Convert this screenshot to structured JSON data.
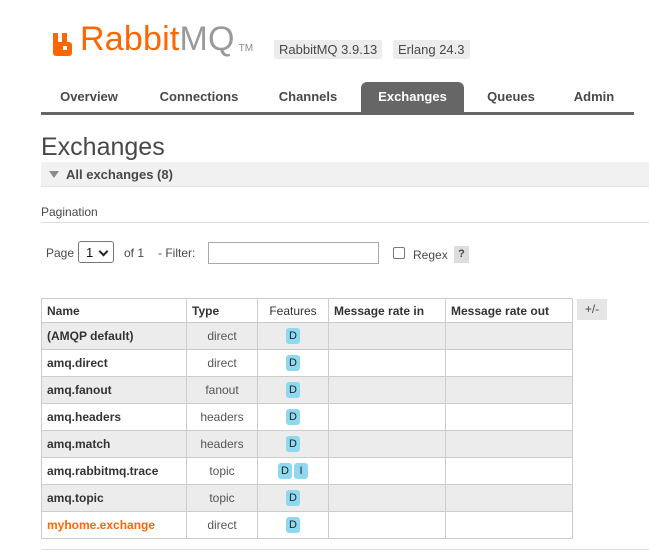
{
  "header": {
    "logo_word": "Rabbit",
    "logo_suffix": "MQ",
    "logo_tm": "TM",
    "version_label": "RabbitMQ 3.9.13",
    "erlang_label": "Erlang 24.3"
  },
  "tabs": [
    "Overview",
    "Connections",
    "Channels",
    "Exchanges",
    "Queues",
    "Admin"
  ],
  "active_tab": "Exchanges",
  "page": {
    "title": "Exchanges",
    "section_title": "All exchanges (8)",
    "pagination_label": "Pagination"
  },
  "pagination": {
    "page_label": "Page",
    "page_value": "1",
    "of_label": "of 1",
    "filter_label": "- Filter:",
    "filter_value": "",
    "regex_label": "Regex",
    "regex_checked": false,
    "help_label": "?"
  },
  "table": {
    "columns": [
      "Name",
      "Type",
      "Features",
      "Message rate in",
      "Message rate out"
    ],
    "toggle_label": "+/-",
    "rows": [
      {
        "name": "(AMQP default)",
        "type": "direct",
        "features": [
          "D"
        ],
        "rate_in": "",
        "rate_out": ""
      },
      {
        "name": "amq.direct",
        "type": "direct",
        "features": [
          "D"
        ],
        "rate_in": "",
        "rate_out": ""
      },
      {
        "name": "amq.fanout",
        "type": "fanout",
        "features": [
          "D"
        ],
        "rate_in": "",
        "rate_out": ""
      },
      {
        "name": "amq.headers",
        "type": "headers",
        "features": [
          "D"
        ],
        "rate_in": "",
        "rate_out": ""
      },
      {
        "name": "amq.match",
        "type": "headers",
        "features": [
          "D"
        ],
        "rate_in": "",
        "rate_out": ""
      },
      {
        "name": "amq.rabbitmq.trace",
        "type": "topic",
        "features": [
          "D",
          "I"
        ],
        "rate_in": "",
        "rate_out": ""
      },
      {
        "name": "amq.topic",
        "type": "topic",
        "features": [
          "D"
        ],
        "rate_in": "",
        "rate_out": ""
      },
      {
        "name": "myhome.exchange",
        "type": "direct",
        "features": [
          "D"
        ],
        "rate_in": "",
        "rate_out": ""
      }
    ]
  },
  "colors": {
    "brand_orange": "#ff6600",
    "tab_active_bg": "#666666",
    "feature_badge": "#8ed8f0",
    "row_odd": "#ececec"
  }
}
